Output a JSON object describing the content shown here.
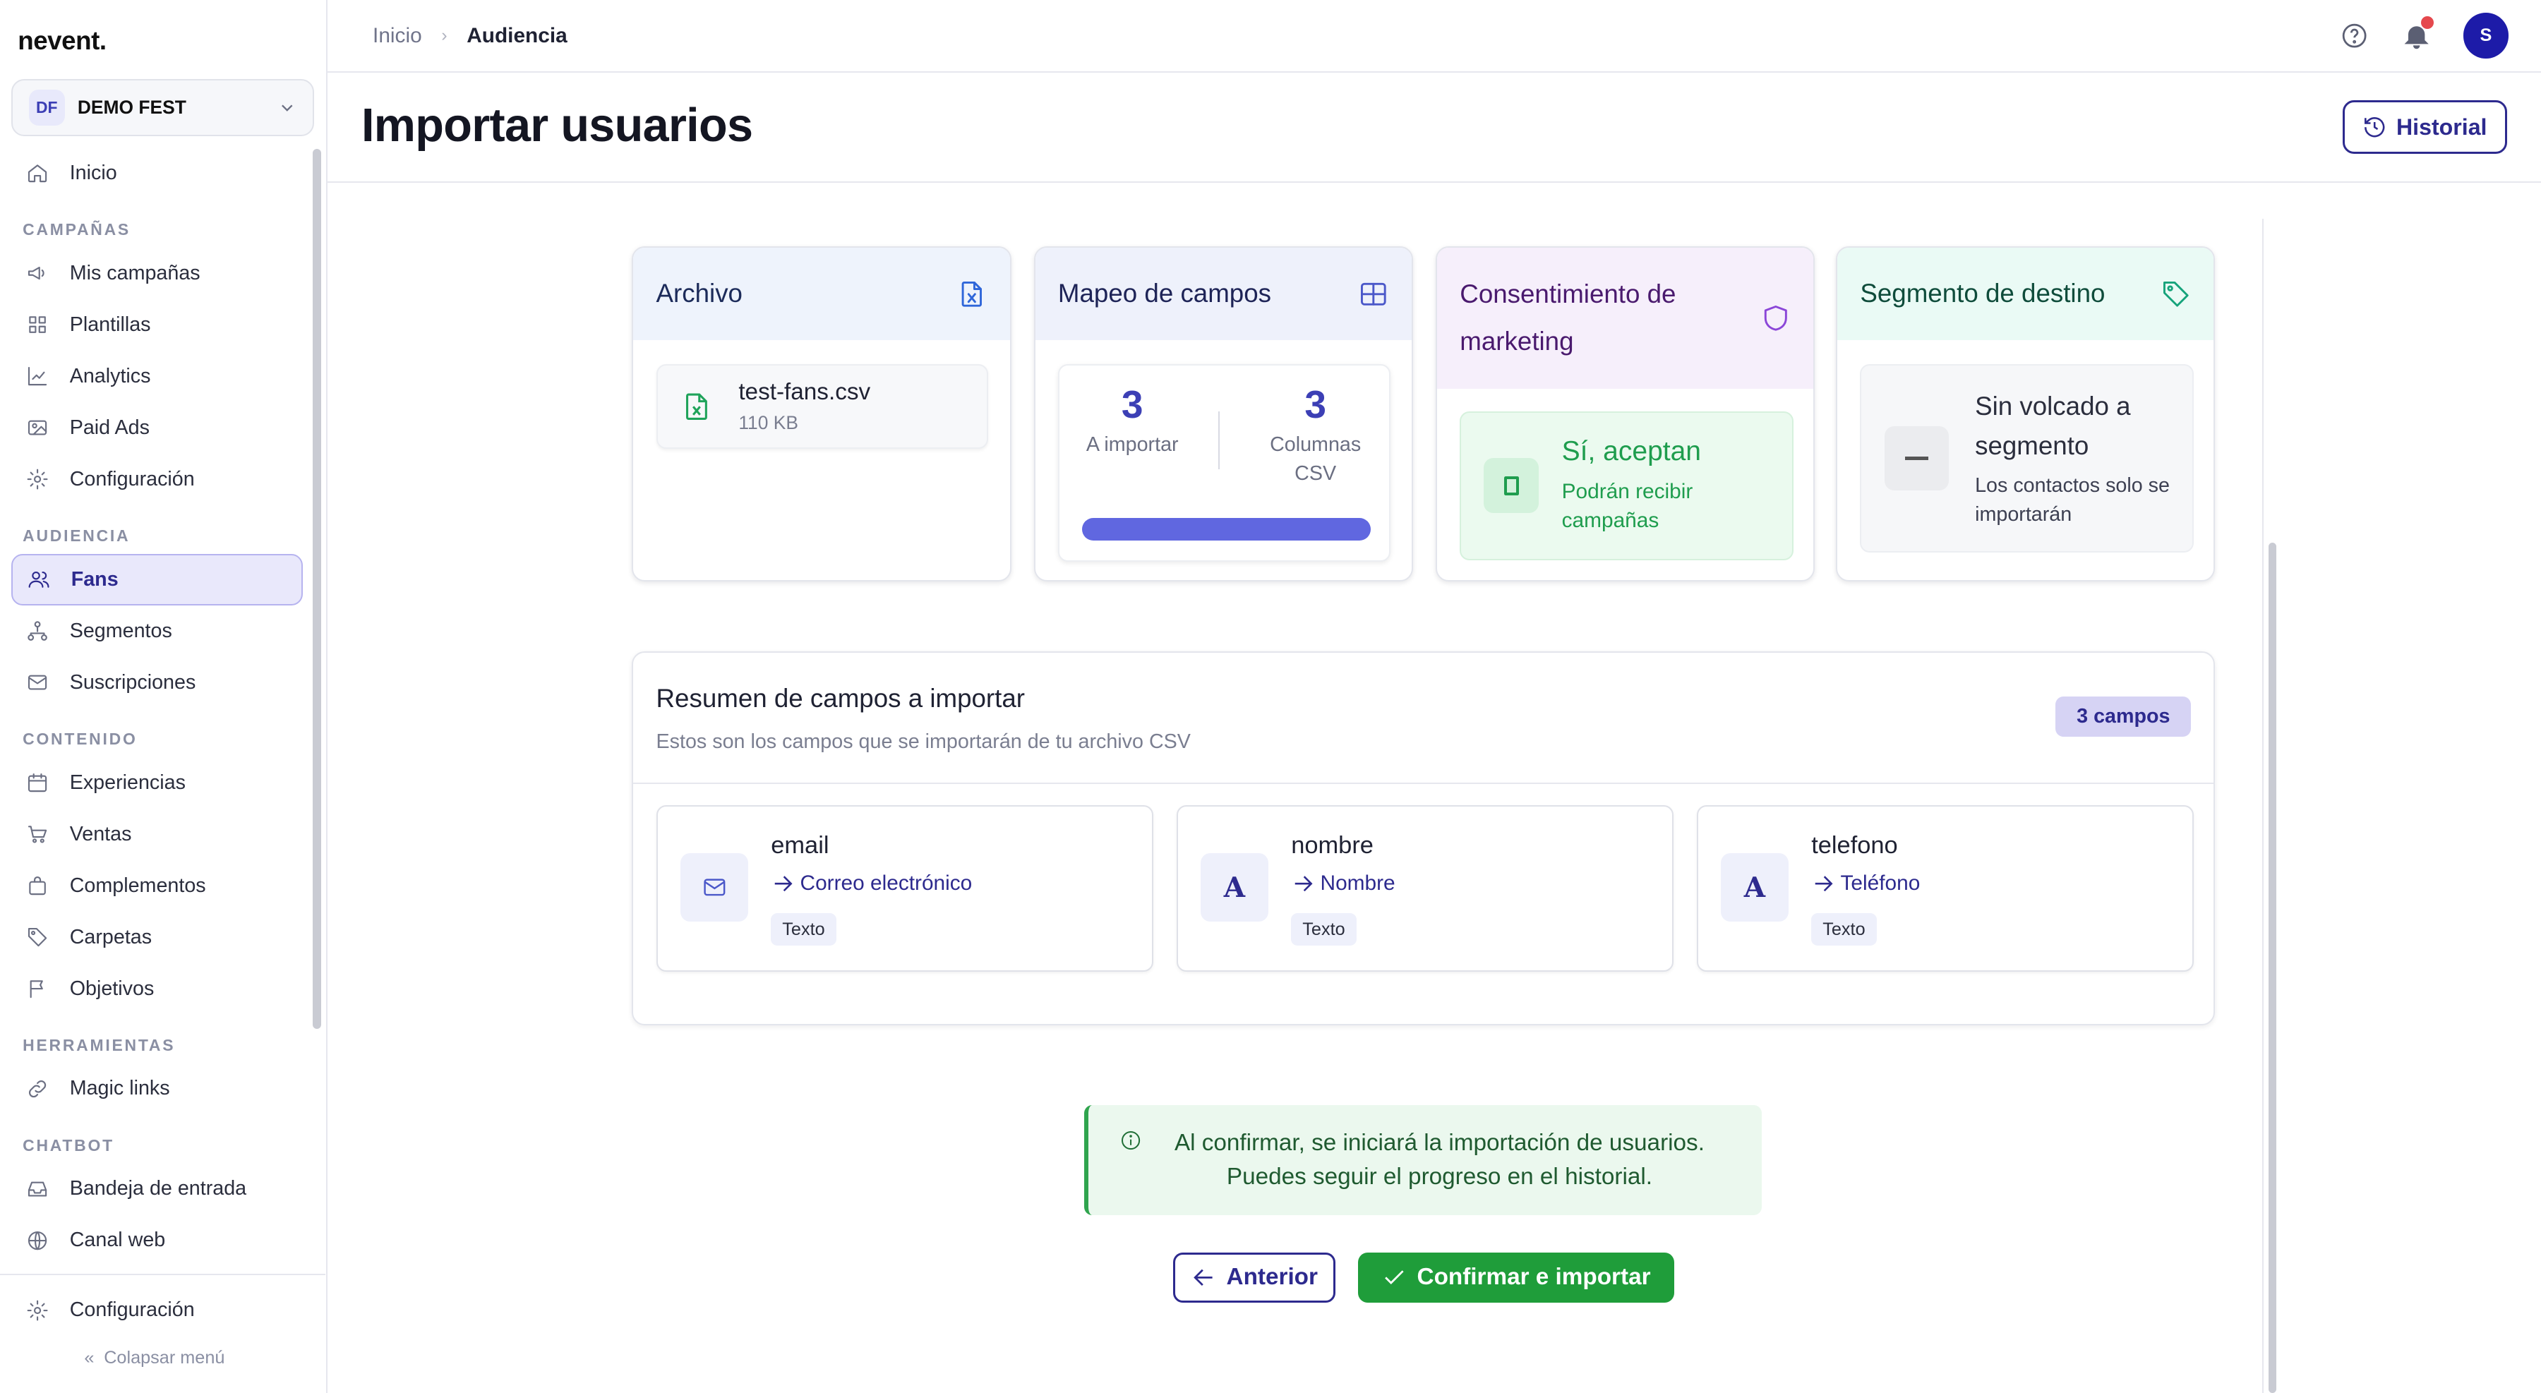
{
  "app": {
    "logo": "nevent."
  },
  "org": {
    "badge": "DF",
    "name": "DEMO FEST"
  },
  "sidebar": {
    "home": "Inicio",
    "sections": [
      {
        "title": "CAMPAÑAS",
        "items": [
          "Mis campañas",
          "Plantillas",
          "Analytics",
          "Paid Ads",
          "Configuración"
        ]
      },
      {
        "title": "AUDIENCIA",
        "items": [
          "Fans",
          "Segmentos",
          "Suscripciones"
        ]
      },
      {
        "title": "CONTENIDO",
        "items": [
          "Experiencias",
          "Ventas",
          "Complementos",
          "Carpetas",
          "Objetivos"
        ]
      },
      {
        "title": "HERRAMIENTAS",
        "items": [
          "Magic links"
        ]
      },
      {
        "title": "CHATBOT",
        "items": [
          "Bandeja de entrada",
          "Canal web"
        ]
      }
    ],
    "footer_settings": "Configuración",
    "collapse": "Colapsar menú"
  },
  "breadcrumb": {
    "root": "Inicio",
    "current": "Audiencia"
  },
  "header": {
    "avatar": "S"
  },
  "page": {
    "title": "Importar usuarios",
    "history_button": "Historial"
  },
  "cards": {
    "file": {
      "title": "Archivo",
      "name": "test-fans.csv",
      "size": "110 KB"
    },
    "mapping": {
      "title": "Mapeo de campos",
      "to_import": "3",
      "to_import_label": "A importar",
      "csv_columns": "3",
      "csv_columns_label": "Columnas CSV",
      "progress": 1.0
    },
    "consent": {
      "title": "Consentimiento de marketing",
      "value": "Sí, aceptan",
      "desc": "Podrán recibir campañas"
    },
    "segment": {
      "title": "Segmento de destino",
      "value": "Sin volcado a segmento",
      "desc": "Los contactos solo se importarán"
    }
  },
  "summary": {
    "title": "Resumen de campos a importar",
    "subtitle": "Estos son los campos que se importarán de tu archivo CSV",
    "badge": "3 campos",
    "fields": [
      {
        "name": "email",
        "maps_to": "Correo electrónico",
        "type": "Texto",
        "icon": "mail-icon"
      },
      {
        "name": "nombre",
        "maps_to": "Nombre",
        "type": "Texto",
        "icon": "text-a-icon"
      },
      {
        "name": "telefono",
        "maps_to": "Teléfono",
        "type": "Texto",
        "icon": "text-a-icon"
      }
    ]
  },
  "alert": {
    "line1": "Al confirmar, se iniciará la importación de usuarios.",
    "line2": "Puedes seguir el progreso en el historial."
  },
  "actions": {
    "previous": "Anterior",
    "confirm": "Confirmar e importar"
  },
  "colors": {
    "primary": "#2d2a8e",
    "success": "#1f9d3a",
    "accent": "#3c3fb5"
  }
}
